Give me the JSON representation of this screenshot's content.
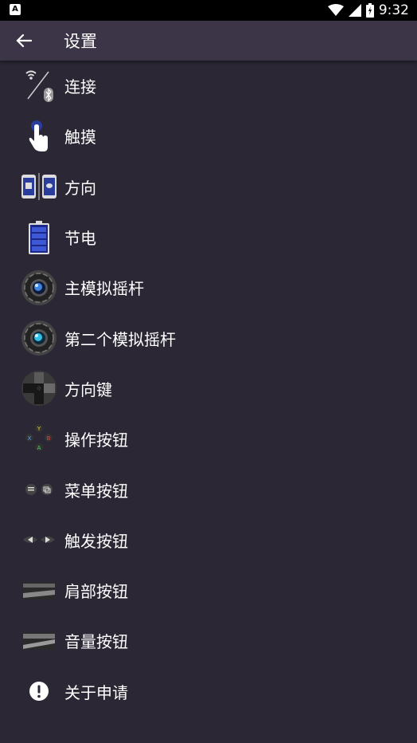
{
  "status_bar": {
    "left_icon": "A",
    "time": "9:32",
    "icons": [
      "wifi-icon",
      "signal-icon",
      "battery-icon"
    ]
  },
  "app_bar": {
    "title": "设置",
    "back_icon": "arrow-left-icon"
  },
  "settings": [
    {
      "label": "连接",
      "icon": "connection-icon"
    },
    {
      "label": "触摸",
      "icon": "touch-icon"
    },
    {
      "label": "方向",
      "icon": "orientation-icon"
    },
    {
      "label": "节电",
      "icon": "battery-saver-icon"
    },
    {
      "label": "主模拟摇杆",
      "icon": "analog-stick-icon"
    },
    {
      "label": "第二个模拟摇杆",
      "icon": "second-analog-stick-icon"
    },
    {
      "label": "方向键",
      "icon": "dpad-icon"
    },
    {
      "label": "操作按钮",
      "icon": "action-buttons-icon"
    },
    {
      "label": "菜单按钮",
      "icon": "menu-buttons-icon"
    },
    {
      "label": "触发按钮",
      "icon": "trigger-buttons-icon"
    },
    {
      "label": "肩部按钮",
      "icon": "shoulder-buttons-icon"
    },
    {
      "label": "音量按钮",
      "icon": "volume-buttons-icon"
    },
    {
      "label": "关于申请",
      "icon": "info-icon"
    }
  ]
}
